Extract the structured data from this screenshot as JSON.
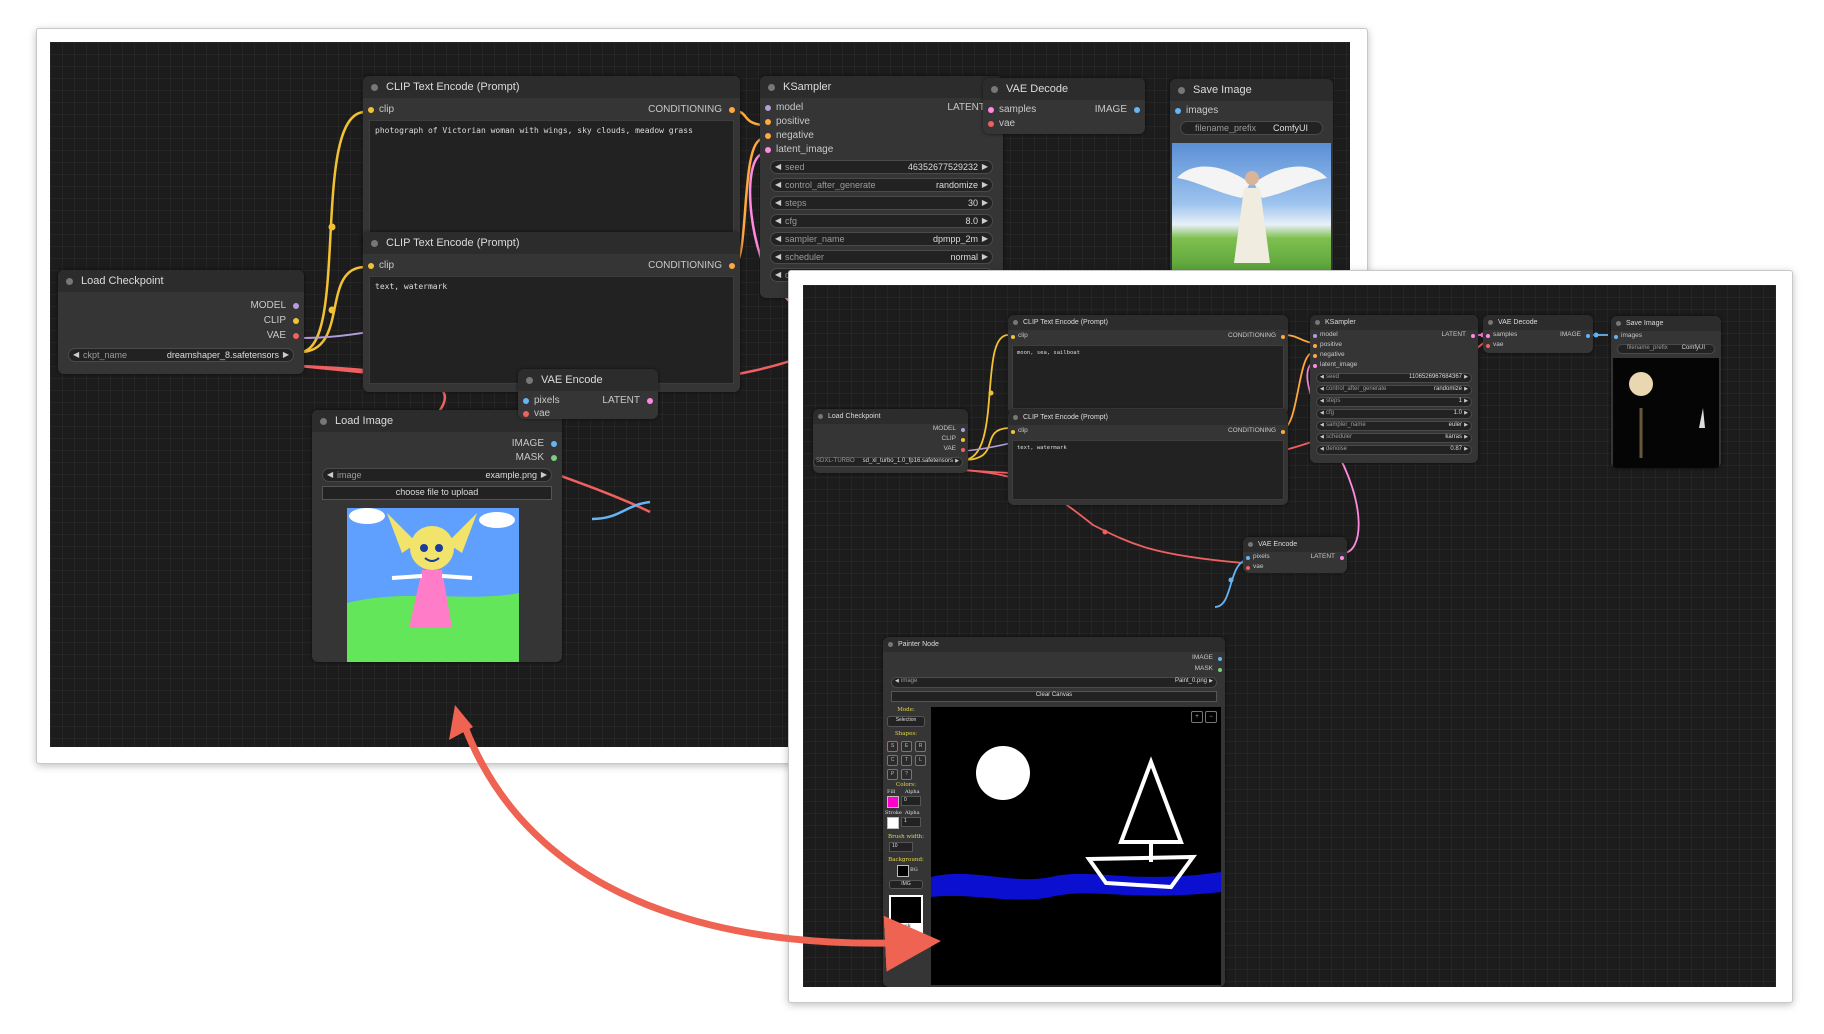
{
  "left": {
    "clip1": {
      "title": "CLIP Text Encode (Prompt)",
      "in": "clip",
      "out": "CONDITIONING",
      "text": "photograph of Victorian woman with wings, sky clouds, meadow grass"
    },
    "clip2": {
      "title": "CLIP Text Encode (Prompt)",
      "in": "clip",
      "out": "CONDITIONING",
      "text": "text, watermark"
    },
    "ksampler": {
      "title": "KSampler",
      "inputs": [
        "model",
        "positive",
        "negative",
        "latent_image"
      ],
      "out": "LATENT",
      "widgets": [
        {
          "label": "seed",
          "value": "46352677529232"
        },
        {
          "label": "control_after_generate",
          "value": "randomize"
        },
        {
          "label": "steps",
          "value": "30"
        },
        {
          "label": "cfg",
          "value": "8.0"
        },
        {
          "label": "sampler_name",
          "value": "dpmpp_2m"
        },
        {
          "label": "scheduler",
          "value": "normal"
        },
        {
          "label": "denoise",
          "value": ""
        }
      ]
    },
    "vaedecode": {
      "title": "VAE Decode",
      "in1": "samples",
      "in2": "vae",
      "out": "IMAGE"
    },
    "save": {
      "title": "Save Image",
      "in": "images",
      "wlabel": "filename_prefix",
      "wvalue": "ComfyUI"
    },
    "checkpoint": {
      "title": "Load Checkpoint",
      "outs": [
        "MODEL",
        "CLIP",
        "VAE"
      ],
      "wlabel": "ckpt_name",
      "wvalue": "dreamshaper_8.safetensors"
    },
    "loadimage": {
      "title": "Load Image",
      "outs": [
        "IMAGE",
        "MASK"
      ],
      "wlabel": "image",
      "wvalue": "example.png",
      "button": "choose file to upload"
    },
    "vaeencode": {
      "title": "VAE Encode",
      "in1": "pixels",
      "in2": "vae",
      "out": "LATENT"
    }
  },
  "right": {
    "clip1": {
      "title": "CLIP Text Encode (Prompt)",
      "in": "clip",
      "out": "CONDITIONING",
      "text": "moon, sea, sailboat"
    },
    "clip2": {
      "title": "CLIP Text Encode (Prompt)",
      "in": "clip",
      "out": "CONDITIONING",
      "text": "text, watermark"
    },
    "ksampler": {
      "title": "KSampler",
      "inputs": [
        "model",
        "positive",
        "negative",
        "latent_image"
      ],
      "out": "LATENT",
      "widgets": [
        {
          "label": "seed",
          "value": "1106526967684367"
        },
        {
          "label": "control_after_generate",
          "value": "randomize"
        },
        {
          "label": "steps",
          "value": "1"
        },
        {
          "label": "cfg",
          "value": "1.0"
        },
        {
          "label": "sampler_name",
          "value": "euler"
        },
        {
          "label": "scheduler",
          "value": "karras"
        },
        {
          "label": "denoise",
          "value": "0.87"
        }
      ]
    },
    "vaedecode": {
      "title": "VAE Decode",
      "in1": "samples",
      "in2": "vae",
      "out": "IMAGE"
    },
    "save": {
      "title": "Save Image",
      "in": "images",
      "wlabel": "filename_prefix",
      "wvalue": "ComfyUI"
    },
    "checkpoint": {
      "title": "Load Checkpoint",
      "outs": [
        "MODEL",
        "CLIP",
        "VAE"
      ],
      "wlabel": "SDXL-TURBO",
      "wvalue": "sd_xl_turbo_1.0_fp16.safetensors"
    },
    "vaeencode": {
      "title": "VAE Encode",
      "in1": "pixels",
      "in2": "vae",
      "out": "LATENT"
    },
    "painter": {
      "title": "Painter Node",
      "outs": [
        "IMAGE",
        "MASK"
      ],
      "wlabel": "image",
      "wvalue": "Paint_0.png",
      "clear": "Clear Canvas",
      "mode_label": "Mode:",
      "mode_value": "Selection",
      "shapes_label": "Shapes:",
      "colors_label": "Colors:",
      "fill": "Fill",
      "stroke": "Stroke",
      "alpha": "Alpha",
      "fill_alpha": "0",
      "stroke_alpha": "1",
      "brush_label": "Brush width:",
      "brush_value": "10",
      "bg_label": "Background:",
      "bg_value": "BG",
      "img_btn": "IMG",
      "mask": "Mask",
      "tools": [
        "S",
        "E",
        "R",
        "C",
        "T",
        "L",
        "P",
        "?"
      ]
    }
  },
  "colors": {
    "clip": "#f2c233",
    "model": "#b39ddb",
    "vae": "#f06060",
    "latent": "#ff8ae2",
    "image": "#64b5f6",
    "cond": "#ffa940",
    "arrow": "#ee6352"
  }
}
